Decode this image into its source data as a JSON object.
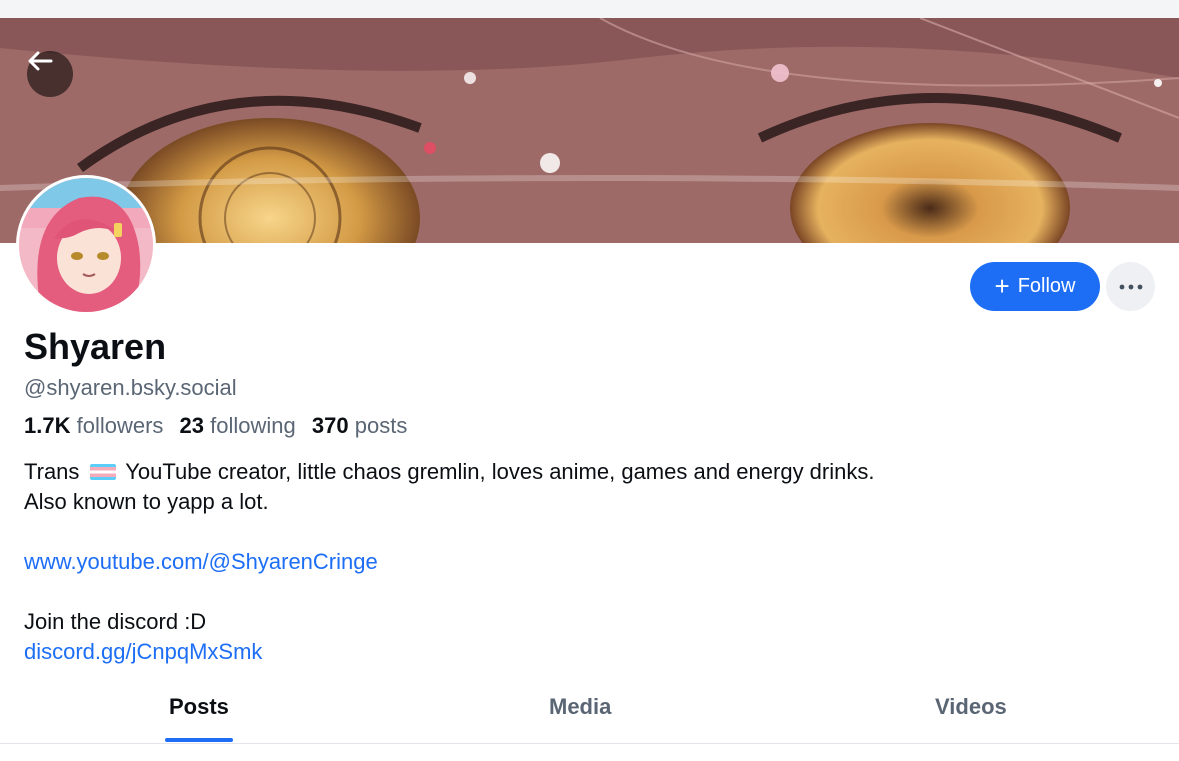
{
  "profile": {
    "display_name": "Shyaren",
    "handle": "@shyaren.bsky.social"
  },
  "stats": {
    "followers_count": "1.7K",
    "followers_label": "followers",
    "following_count": "23",
    "following_label": "following",
    "posts_count": "370",
    "posts_label": "posts"
  },
  "bio": {
    "line1_prefix": "Trans",
    "line1_suffix": "YouTube creator, little chaos gremlin, loves anime, games and energy drinks.",
    "line2": "Also known to yapp a lot.",
    "youtube_link": "www.youtube.com/@ShyarenCringe",
    "discord_text": "Join the discord :D",
    "discord_link": "discord.gg/jCnpqMxSmk"
  },
  "actions": {
    "follow_label": "Follow",
    "follow_icon": "plus-icon",
    "more_icon": "ellipsis-icon",
    "back_icon": "arrow-left-icon"
  },
  "tabs": [
    {
      "label": "Posts",
      "active": true
    },
    {
      "label": "Media",
      "active": false
    },
    {
      "label": "Videos",
      "active": false
    }
  ],
  "colors": {
    "accent": "#1d6ef5",
    "muted_text": "#5b6675",
    "link": "#1d6ef5"
  }
}
